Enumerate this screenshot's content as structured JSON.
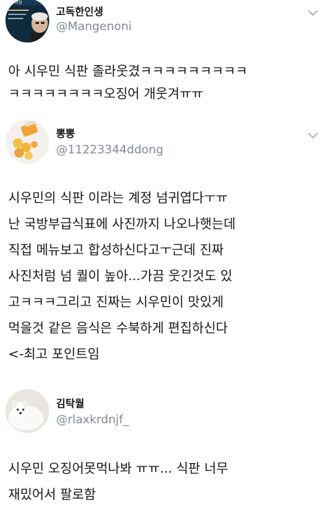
{
  "tweets": [
    {
      "name": "고독한인생",
      "handle": "@Mangenoni",
      "avatar_icon": "warren-buffett-book-cover-avatar",
      "text": "아 시우민 식판 졸라웃겼ㅋㅋㅋㅋㅋㅋㅋㅋㅋ\nㅋㅋㅋㅋㅋㅋㅋㅋ오징어 개웃겨ㅠㅠ"
    },
    {
      "name": "뽕뽕",
      "handle": "@11223344ddong",
      "avatar_icon": "orange-pills-bottle-avatar",
      "text": "시우민의 식판 이라는 계정 넘귀엽다ㅜㅠ\n난 국방부급식표에 사진까지 나오나햇는데\n직접 메뉴보고 합성하신다고ㅜ근데 진짜\n사진처럼 넘 퀄이 높아...가끔 웃긴것도 있\n고ㅋㅋㅋ그리고 진짜는 시우민이 맛있게\n먹을것 같은 음식은 수북하게 편집하신다\n<-최고 포인트임"
    },
    {
      "name": "김탁월",
      "handle": "@rlaxkrdnjf_",
      "avatar_icon": "white-dog-avatar",
      "text": "시우민 오징어못먹나봐 ㅠㅠ... 식판 너무\n재밌어서 팔로함"
    }
  ],
  "colors": {
    "text": "#14171a",
    "handle": "#7f8a95",
    "chevron": "#aab8c2"
  }
}
